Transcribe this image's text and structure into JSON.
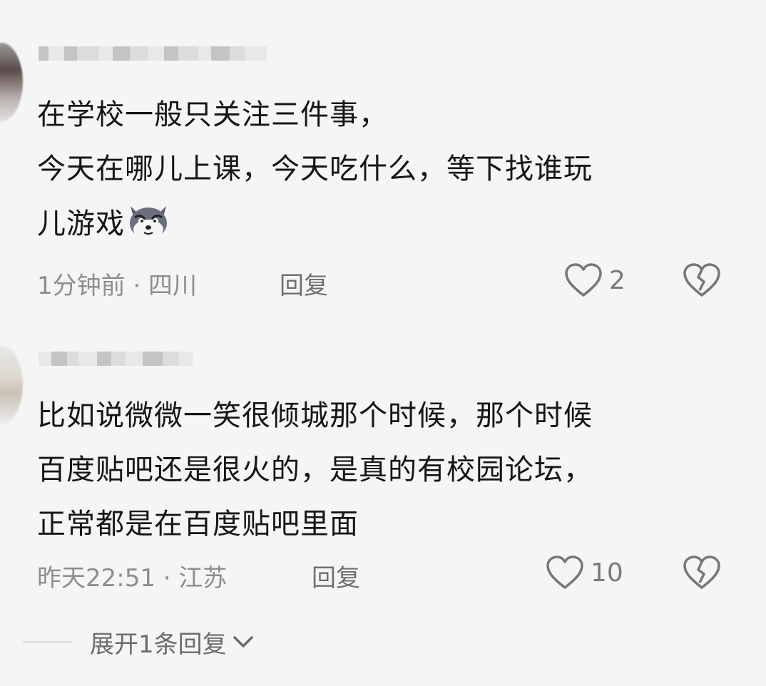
{
  "comments": [
    {
      "text": "在学校一般只关注三件事，\n今天在哪儿上课，今天吃什么，等下找谁玩\n儿游戏",
      "emoji": "wolf-emoji",
      "meta": "1分钟前 · 四川",
      "reply_label": "回复",
      "like_count": "2"
    },
    {
      "text": "比如说微微一笑很倾城那个时候，那个时候\n百度贴吧还是很火的，是真的有校园论坛，\n正常都是在百度贴吧里面",
      "meta": "昨天22:51 · 江苏",
      "reply_label": "回复",
      "like_count": "10"
    }
  ],
  "expand_replies": "展开1条回复",
  "colors": {
    "background": "#f5f5f5",
    "text": "#161616",
    "meta": "#8e8e8e"
  }
}
